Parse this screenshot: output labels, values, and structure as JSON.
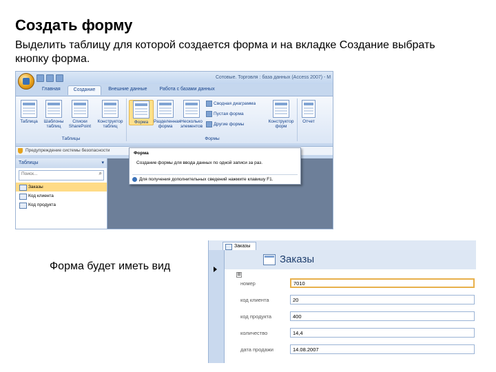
{
  "slide": {
    "title": "Создать форму",
    "description": "Выделить таблицу для которой создается форма и на вкладке Создание выбрать кнопку форма.",
    "caption": "Форма будет иметь вид"
  },
  "access_window": {
    "title": "Сотовые. Торговля : база данных (Access 2007) - M",
    "tabs": [
      "Главная",
      "Создание",
      "Внешние данные",
      "Работа с базами данных"
    ],
    "active_tab": "Создание",
    "ribbon": {
      "tables_group": {
        "caption": "Таблицы",
        "buttons": [
          "Таблица",
          "Шаблоны таблиц",
          "Списки SharePoint",
          "Конструктор таблиц"
        ]
      },
      "forms_group": {
        "caption": "Формы",
        "buttons": [
          "Форма",
          "Разделенная форма",
          "Несколько элементов",
          "Конструктор форм"
        ],
        "small_items": [
          "Сводная диаграмма",
          "Пустая форма",
          "Другие формы"
        ]
      },
      "reports_group": {
        "buttons": [
          "Отчет"
        ]
      }
    },
    "security_bar": "Предупреждение системы безопасности",
    "nav_pane": {
      "header": "Таблицы",
      "search_placeholder": "Поиск...",
      "items": [
        "Заказы",
        "Код клиента",
        "Код продукта"
      ],
      "selected_index": 0
    },
    "tooltip": {
      "title": "Форма",
      "body": "Создание формы для ввода данных по одной записи за раз.",
      "help": "Для получения дополнительных сведений нажмите клавишу F1."
    }
  },
  "form_view": {
    "tab_label": "Заказы",
    "header_title": "Заказы",
    "expand_glyph": "⊟",
    "fields": [
      {
        "label": "номер",
        "value": "7010"
      },
      {
        "label": "код клиента",
        "value": "20"
      },
      {
        "label": "код продукта",
        "value": "400"
      },
      {
        "label": "количество",
        "value": "14,4"
      },
      {
        "label": "дата продажи",
        "value": "14.08.2007"
      }
    ]
  },
  "icons": {
    "office_button": "office-logo-icon",
    "search": "search-icon",
    "shield": "shield-icon",
    "help": "help-icon",
    "record_selector": "triangle-right-icon"
  },
  "colors": {
    "ribbon_text": "#15428b",
    "selection_highlight": "#ffdb86",
    "focus_border": "#e8b04a",
    "form_title": "#1f3f6e"
  }
}
